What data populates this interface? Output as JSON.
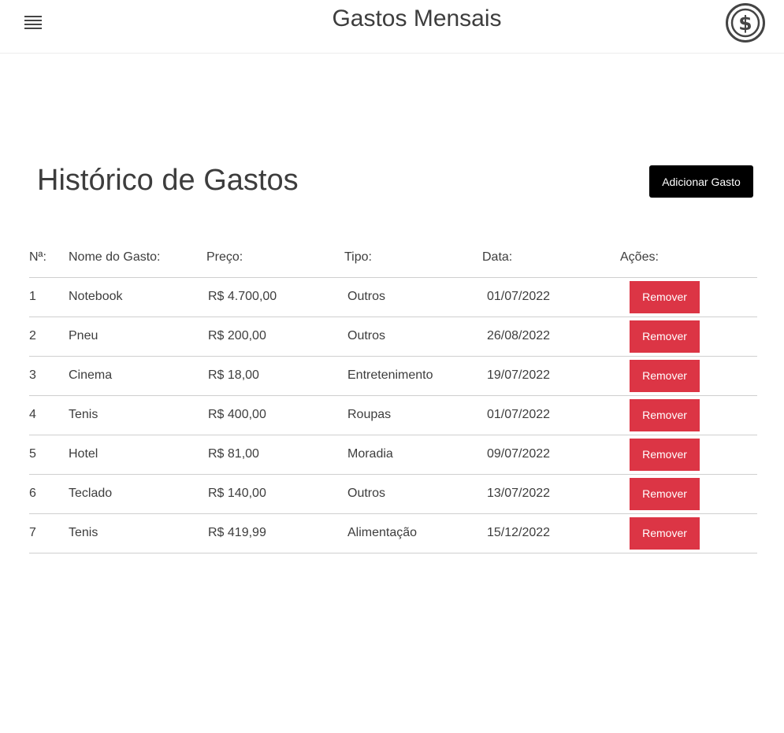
{
  "header": {
    "title": "Gastos Mensais",
    "menu_icon": "hamburger-menu-icon",
    "logo_icon": "dollar-coin-icon"
  },
  "main": {
    "title": "Histórico de Gastos",
    "add_button_label": "Adicionar Gasto"
  },
  "table": {
    "columns": [
      "Nª:",
      "Nome do Gasto:",
      "Preço:",
      "Tipo:",
      "Data:",
      "Ações:"
    ],
    "rows": [
      {
        "num": "1",
        "name": "Notebook",
        "price": "R$ 4.700,00",
        "type": "Outros",
        "date": "01/07/2022",
        "action": "Remover"
      },
      {
        "num": "2",
        "name": "Pneu",
        "price": "R$ 200,00",
        "type": "Outros",
        "date": "26/08/2022",
        "action": "Remover"
      },
      {
        "num": "3",
        "name": "Cinema",
        "price": "R$ 18,00",
        "type": "Entretenimento",
        "date": "19/07/2022",
        "action": "Remover"
      },
      {
        "num": "4",
        "name": "Tenis",
        "price": "R$ 400,00",
        "type": "Roupas",
        "date": "01/07/2022",
        "action": "Remover"
      },
      {
        "num": "5",
        "name": "Hotel",
        "price": "R$ 81,00",
        "type": "Moradia",
        "date": "09/07/2022",
        "action": "Remover"
      },
      {
        "num": "6",
        "name": "Teclado",
        "price": "R$ 140,00",
        "type": "Outros",
        "date": "13/07/2022",
        "action": "Remover"
      },
      {
        "num": "7",
        "name": "Tenis",
        "price": "R$ 419,99",
        "type": "Alimentação",
        "date": "15/12/2022",
        "action": "Remover"
      }
    ]
  },
  "colors": {
    "remove_button": "#dc3545",
    "add_button": "#000000",
    "text": "#3d3d3d"
  }
}
